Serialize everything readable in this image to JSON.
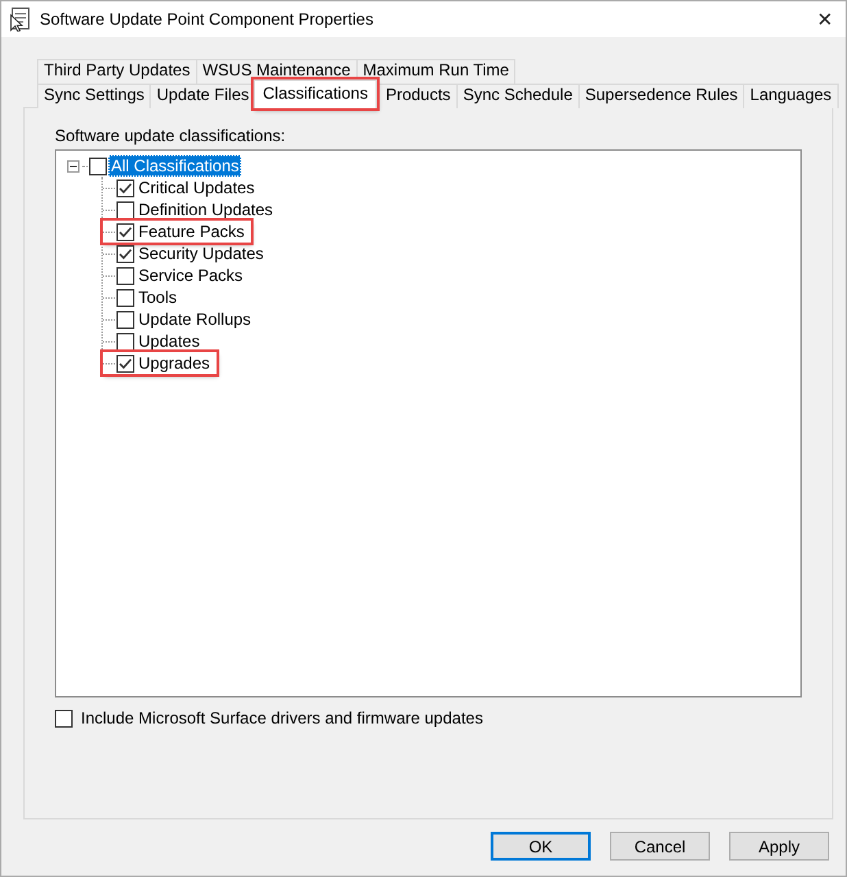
{
  "window": {
    "title": "Software Update Point Component Properties",
    "close": "✕"
  },
  "tab_rows": [
    [
      {
        "label": "Third Party Updates",
        "selected": false,
        "highlighted": false
      },
      {
        "label": "WSUS Maintenance",
        "selected": false,
        "highlighted": false
      },
      {
        "label": "Maximum Run Time",
        "selected": false,
        "highlighted": false
      }
    ],
    [
      {
        "label": "Sync Settings",
        "selected": false,
        "highlighted": false
      },
      {
        "label": "Update Files",
        "selected": false,
        "highlighted": false
      },
      {
        "label": "Classifications",
        "selected": true,
        "highlighted": true
      },
      {
        "label": "Products",
        "selected": false,
        "highlighted": false
      },
      {
        "label": "Sync Schedule",
        "selected": false,
        "highlighted": false
      },
      {
        "label": "Supersedence Rules",
        "selected": false,
        "highlighted": false
      },
      {
        "label": "Languages",
        "selected": false,
        "highlighted": false
      }
    ]
  ],
  "classifications_label": "Software update classifications:",
  "tree": {
    "label": "All Classifications",
    "checked": false,
    "selected": true,
    "expanded": true,
    "children": [
      {
        "label": "Critical Updates",
        "checked": true,
        "highlighted": false
      },
      {
        "label": "Definition Updates",
        "checked": false,
        "highlighted": false
      },
      {
        "label": "Feature Packs",
        "checked": true,
        "highlighted": true
      },
      {
        "label": "Security Updates",
        "checked": true,
        "highlighted": false
      },
      {
        "label": "Service Packs",
        "checked": false,
        "highlighted": false
      },
      {
        "label": "Tools",
        "checked": false,
        "highlighted": false
      },
      {
        "label": "Update Rollups",
        "checked": false,
        "highlighted": false
      },
      {
        "label": "Updates",
        "checked": false,
        "highlighted": false
      },
      {
        "label": "Upgrades",
        "checked": true,
        "highlighted": true
      }
    ]
  },
  "surface_option": {
    "label": "Include Microsoft Surface drivers and firmware updates",
    "checked": false
  },
  "buttons": [
    {
      "label": "OK",
      "default": true
    },
    {
      "label": "Cancel",
      "default": false
    },
    {
      "label": "Apply",
      "default": false
    }
  ]
}
